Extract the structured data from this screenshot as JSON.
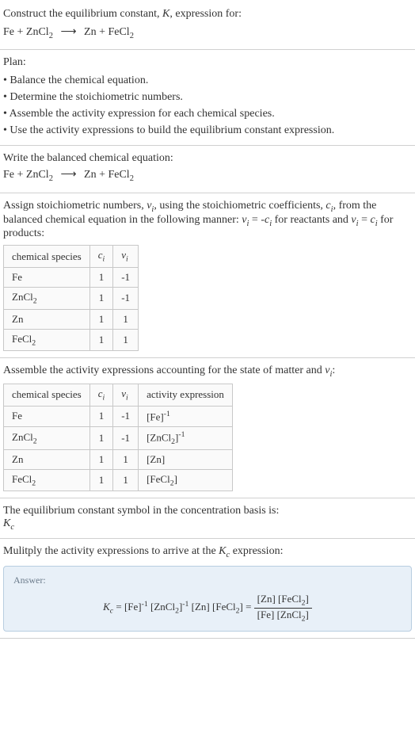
{
  "header": {
    "line1": "Construct the equilibrium constant, K, expression for:",
    "equation_lhs": "Fe + ZnCl",
    "equation_rhs": "Zn + FeCl"
  },
  "plan": {
    "title": "Plan:",
    "items": [
      "• Balance the chemical equation.",
      "• Determine the stoichiometric numbers.",
      "• Assemble the activity expression for each chemical species.",
      "• Use the activity expressions to build the equilibrium constant expression."
    ]
  },
  "balanced": {
    "title": "Write the balanced chemical equation:"
  },
  "stoich": {
    "intro1": "Assign stoichiometric numbers, ",
    "intro2": ", using the stoichiometric coefficients, ",
    "intro3": ", from the balanced chemical equation in the following manner: ",
    "intro4": " for reactants and ",
    "intro5": " for products:",
    "headers": [
      "chemical species",
      "cᵢ",
      "νᵢ"
    ],
    "rows": [
      {
        "species": "Fe",
        "c": "1",
        "v": "-1"
      },
      {
        "species": "ZnCl₂",
        "c": "1",
        "v": "-1"
      },
      {
        "species": "Zn",
        "c": "1",
        "v": "1"
      },
      {
        "species": "FeCl₂",
        "c": "1",
        "v": "1"
      }
    ]
  },
  "activity": {
    "title": "Assemble the activity expressions accounting for the state of matter and νᵢ:",
    "headers": [
      "chemical species",
      "cᵢ",
      "νᵢ",
      "activity expression"
    ],
    "rows": [
      {
        "species": "Fe",
        "c": "1",
        "v": "-1",
        "expr": "[Fe]⁻¹"
      },
      {
        "species": "ZnCl₂",
        "c": "1",
        "v": "-1",
        "expr": "[ZnCl₂]⁻¹"
      },
      {
        "species": "Zn",
        "c": "1",
        "v": "1",
        "expr": "[Zn]"
      },
      {
        "species": "FeCl₂",
        "c": "1",
        "v": "1",
        "expr": "[FeCl₂]"
      }
    ]
  },
  "symbol": {
    "line1": "The equilibrium constant symbol in the concentration basis is:",
    "line2": "K_c"
  },
  "multiply": {
    "title": "Mulitply the activity expressions to arrive at the K_c expression:"
  },
  "answer": {
    "label": "Answer:",
    "kc_eq": "K_c = [Fe]⁻¹ [ZnCl₂]⁻¹ [Zn] [FeCl₂] =",
    "frac_num": "[Zn] [FeCl₂]",
    "frac_den": "[Fe] [ZnCl₂]"
  }
}
